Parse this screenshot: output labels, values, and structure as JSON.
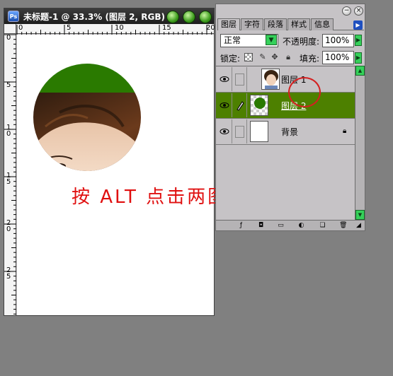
{
  "document": {
    "title": "未标题-1 @ 33.3% (图层 2, RGB)",
    "ps_icon": "Ps",
    "ruler_top_labels": [
      "0",
      "5",
      "10",
      "15",
      "20"
    ],
    "ruler_left_labels": [
      "0",
      "5",
      "1\n0",
      "1\n5",
      "2\n0",
      "2\n5"
    ]
  },
  "annotation": {
    "text": "按 ALT 点击两图层之间间",
    "color": "#e01010"
  },
  "layers_panel": {
    "tabs": [
      "图层",
      "字符",
      "段落",
      "样式",
      "信息"
    ],
    "active_tab": "图层",
    "blend_mode": "正常",
    "opacity_label": "不透明度:",
    "opacity_value": "100%",
    "lock_label": "锁定:",
    "fill_label": "填充:",
    "fill_value": "100%",
    "layers": [
      {
        "name": "图层 1",
        "visible": true,
        "selected": false,
        "clipped": true
      },
      {
        "name": "图层 2",
        "visible": true,
        "selected": true,
        "clipped": false
      },
      {
        "name": "背景",
        "visible": true,
        "selected": false,
        "locked": true
      }
    ],
    "selected_color": "#4d8000"
  },
  "colors": {
    "workspace": "#808080",
    "circle_green": "#2a7a00",
    "annotation_red": "#e01010"
  }
}
